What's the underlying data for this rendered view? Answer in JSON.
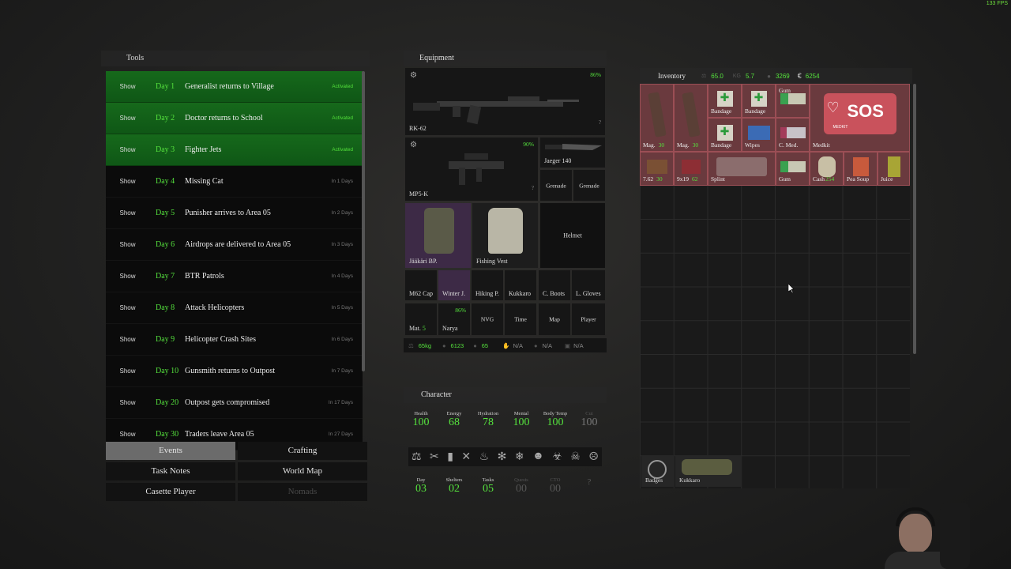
{
  "fps": "133 FPS",
  "tools": {
    "title": "Tools",
    "events": [
      {
        "show": "Show",
        "day": "Day 1",
        "name": "Generalist returns to Village",
        "status": "Activated",
        "active": true
      },
      {
        "show": "Show",
        "day": "Day 2",
        "name": "Doctor returns to School",
        "status": "Activated",
        "active": true
      },
      {
        "show": "Show",
        "day": "Day 3",
        "name": "Fighter Jets",
        "status": "Activated",
        "active": true
      },
      {
        "show": "Show",
        "day": "Day 4",
        "name": "Missing Cat",
        "status": "In 1 Days",
        "active": false
      },
      {
        "show": "Show",
        "day": "Day 5",
        "name": "Punisher arrives to Area 05",
        "status": "In 2 Days",
        "active": false
      },
      {
        "show": "Show",
        "day": "Day 6",
        "name": "Airdrops are delivered to Area 05",
        "status": "In 3 Days",
        "active": false
      },
      {
        "show": "Show",
        "day": "Day 7",
        "name": "BTR Patrols",
        "status": "In 4 Days",
        "active": false
      },
      {
        "show": "Show",
        "day": "Day 8",
        "name": "Attack Helicopters",
        "status": "In 5 Days",
        "active": false
      },
      {
        "show": "Show",
        "day": "Day 9",
        "name": "Helicopter Crash Sites",
        "status": "In 6 Days",
        "active": false
      },
      {
        "show": "Show",
        "day": "Day 10",
        "name": "Gunsmith returns to Outpost",
        "status": "In 7 Days",
        "active": false
      },
      {
        "show": "Show",
        "day": "Day 20",
        "name": "Outpost gets compromised",
        "status": "In 17 Days",
        "active": false
      },
      {
        "show": "Show",
        "day": "Day 30",
        "name": "Traders leave Area 05",
        "status": "In 27 Days",
        "active": false
      }
    ],
    "tabs": [
      "Events",
      "Crafting",
      "Task Notes",
      "World Map",
      "Casette Player",
      "Nomads"
    ]
  },
  "equipment": {
    "title": "Equipment",
    "primary": {
      "name": "RK-62",
      "condition": "86%",
      "extra": "?"
    },
    "secondary": {
      "name": "MP5-K",
      "condition": "90%",
      "extra": "?"
    },
    "knife": "Jaeger 140",
    "grenade1": "Grenade",
    "grenade2": "Grenade",
    "backpack": "Jääkäri BP.",
    "vest": "Fishing Vest",
    "helmet": "Helmet",
    "row1": [
      "M62 Cap",
      "Winter J.",
      "Hiking P.",
      "Kukkaro",
      "C. Boots",
      "L. Gloves"
    ],
    "mat": {
      "name": "Mat.",
      "count": "5"
    },
    "narya": {
      "name": "Narya",
      "condition": "86%"
    },
    "row2": [
      "NVG",
      "Time",
      "Map",
      "Player"
    ],
    "bar": {
      "weight": "65kg",
      "money": "6123",
      "stat": "65",
      "na1": "N/A",
      "na2": "N/A",
      "na3": "N/A"
    }
  },
  "character": {
    "title": "Character",
    "stats": [
      {
        "label": "Health",
        "value": "100"
      },
      {
        "label": "Energy",
        "value": "68"
      },
      {
        "label": "Hydration",
        "value": "78"
      },
      {
        "label": "Mental",
        "value": "100"
      },
      {
        "label": "Body Temp",
        "value": "100"
      },
      {
        "label": "Cut",
        "value": "100"
      }
    ],
    "counters": [
      {
        "label": "Day",
        "value": "03"
      },
      {
        "label": "Shelters",
        "value": "02"
      },
      {
        "label": "Tasks",
        "value": "05"
      },
      {
        "label": "Quests",
        "value": "00"
      },
      {
        "label": "CTO",
        "value": "00"
      },
      {
        "label": "",
        "value": "?"
      }
    ]
  },
  "inventory": {
    "title": "Inventory",
    "weight": "65.0",
    "kg": "5.7",
    "money": "3269",
    "euro": "6254",
    "items": {
      "mag1": {
        "name": "Mag.",
        "count": "30"
      },
      "mag2": {
        "name": "Mag.",
        "count": "30"
      },
      "bandage1": "Bandage",
      "bandage2": "Bandage",
      "bandage3": "Bandage",
      "gum1": "Gum",
      "wipes": "Wipes",
      "cmed": "C. Med.",
      "medkit": "Medkit",
      "sos": "SOS",
      "medkit_sub": "MEDKIT",
      "ammo762": {
        "name": "7.62",
        "count": "30"
      },
      "ammo9": {
        "name": "9x19",
        "count": "62"
      },
      "splint": "Splint",
      "gum2": "Gum",
      "cash": {
        "name": "Cash",
        "count": "254"
      },
      "peasoup": "Pea Soup",
      "juice": "Juice"
    },
    "bottom": [
      "Badges",
      "Kukkaro"
    ]
  }
}
